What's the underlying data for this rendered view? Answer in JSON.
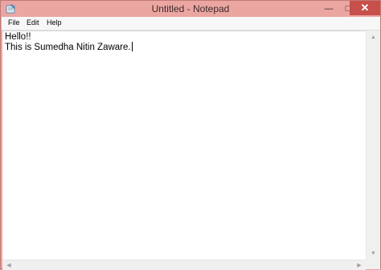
{
  "window": {
    "title": "Untitled - Notepad",
    "icon": "notepad-icon",
    "controls": {
      "minimize": "—",
      "maximize": "□",
      "close": "✕"
    }
  },
  "menu": {
    "items": [
      {
        "label": "File"
      },
      {
        "label": "Edit"
      },
      {
        "label": "Help"
      }
    ]
  },
  "editor": {
    "lines": [
      "Hello!!",
      "This is Sumedha Nitin Zaware."
    ]
  },
  "scrollbars": {
    "up": "▲",
    "down": "▼",
    "left": "◀",
    "right": "▶"
  },
  "colors": {
    "frame": "#eba6a2",
    "close_button": "#c7504a",
    "editor_bg": "#ffffff"
  }
}
